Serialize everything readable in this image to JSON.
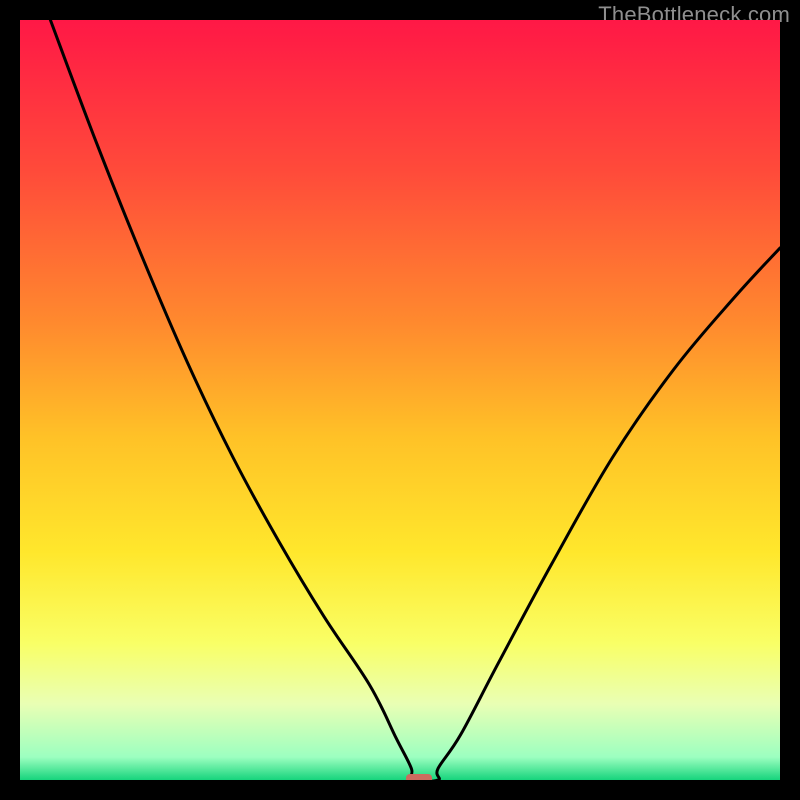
{
  "watermark": {
    "text": "TheBottleneck.com"
  },
  "chart_data": {
    "type": "line",
    "title": "",
    "xlabel": "",
    "ylabel": "",
    "xlim": [
      0,
      100
    ],
    "ylim": [
      0,
      100
    ],
    "optimum_x": 52.5,
    "marker": {
      "x": 52.5,
      "y": 0,
      "color": "#cb6b5f"
    },
    "gradient_stops": [
      {
        "offset": 0.0,
        "color": "#ff1846"
      },
      {
        "offset": 0.2,
        "color": "#ff4b3a"
      },
      {
        "offset": 0.4,
        "color": "#ff8a2e"
      },
      {
        "offset": 0.55,
        "color": "#ffc227"
      },
      {
        "offset": 0.7,
        "color": "#ffe72c"
      },
      {
        "offset": 0.82,
        "color": "#f9ff66"
      },
      {
        "offset": 0.9,
        "color": "#e9ffb4"
      },
      {
        "offset": 0.97,
        "color": "#9cffc0"
      },
      {
        "offset": 1.0,
        "color": "#16d47c"
      }
    ],
    "series": [
      {
        "name": "left",
        "x": [
          4.0,
          10.0,
          16.0,
          22.0,
          28.0,
          34.0,
          40.0,
          46.0,
          49.5,
          51.5
        ],
        "y": [
          100.0,
          84.0,
          69.0,
          55.0,
          42.5,
          31.5,
          21.5,
          12.5,
          5.5,
          1.5
        ]
      },
      {
        "name": "floor",
        "x": [
          51.5,
          55.0
        ],
        "y": [
          0.0,
          0.0
        ]
      },
      {
        "name": "right",
        "x": [
          55.0,
          58.0,
          63.0,
          70.0,
          78.0,
          86.0,
          94.0,
          100.0
        ],
        "y": [
          1.5,
          6.0,
          15.5,
          28.5,
          42.5,
          54.0,
          63.5,
          70.0
        ]
      }
    ]
  }
}
